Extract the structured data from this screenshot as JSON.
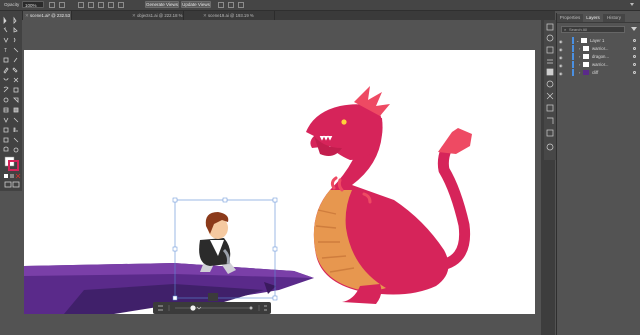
{
  "control_bar": {
    "opacity_label": "Opacity",
    "opacity_value": "100%",
    "generate_views_label": "Generate Views",
    "update_views_label": "Update Views"
  },
  "document_tabs": [
    {
      "label": "scene1.ai* @ 232.53 % (RGB/Preview)",
      "active": true
    },
    {
      "label": "objects1.ai @ 222.18 % (RGB/Preview)",
      "active": false
    },
    {
      "label": "scene19.ai @ 193.19 % (RGB/Preview)",
      "active": false
    }
  ],
  "panel": {
    "tabs": [
      "Properties",
      "Layers",
      "History"
    ],
    "active_tab": "Layers",
    "search_placeholder": "Search All",
    "layers": [
      {
        "name": "Layer 1",
        "level": 0
      },
      {
        "name": "warrior...",
        "level": 1
      },
      {
        "name": "dragon...",
        "level": 1
      },
      {
        "name": "warrior...",
        "level": 1
      },
      {
        "name": "cliff",
        "level": 1
      }
    ]
  },
  "colors": {
    "dragon": "#d6245a",
    "dragon_belly": "#e7974f",
    "dragon_spikes": "#ee4a63",
    "cliff": "#5a2a8a",
    "cliff_dark": "#40206a",
    "selection": "#5a8ad6",
    "layer_accent": "#4a90e2"
  }
}
